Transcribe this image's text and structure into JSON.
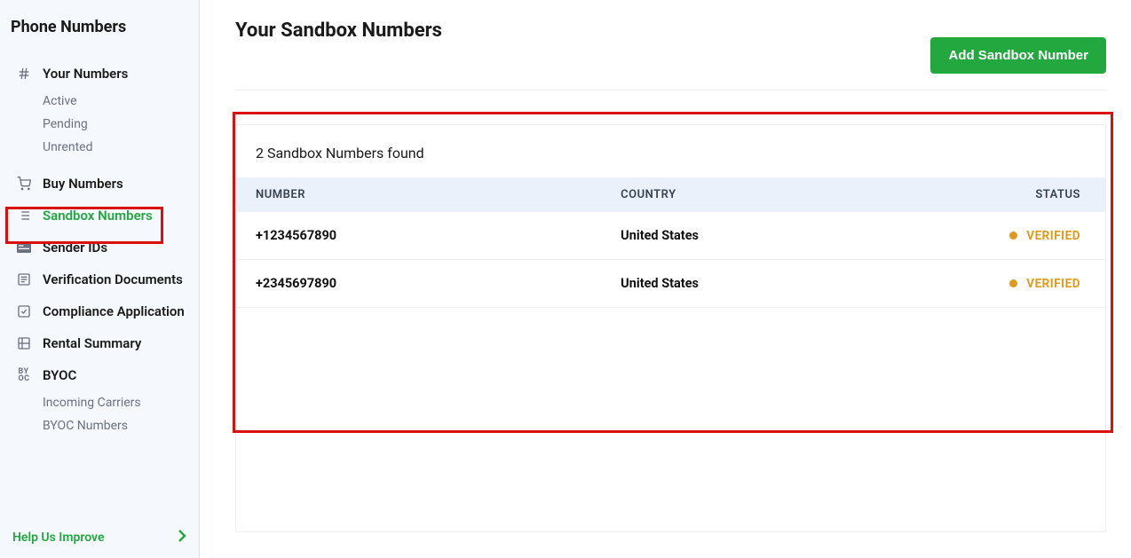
{
  "sidebar": {
    "title": "Phone Numbers",
    "items": [
      {
        "label": "Your Numbers",
        "icon": "#",
        "sub": [
          {
            "label": "Active"
          },
          {
            "label": "Pending"
          },
          {
            "label": "Unrented"
          }
        ]
      },
      {
        "label": "Buy Numbers",
        "icon": "cart"
      },
      {
        "label": "Sandbox Numbers",
        "icon": "list",
        "active": true
      },
      {
        "label": "Sender IDs",
        "icon": "id"
      },
      {
        "label": "Verification Documents",
        "icon": "doc"
      },
      {
        "label": "Compliance Application",
        "icon": "compliance"
      },
      {
        "label": "Rental Summary",
        "icon": "summary"
      },
      {
        "label": "BYOC",
        "icon": "byoc",
        "sub": [
          {
            "label": "Incoming Carriers"
          },
          {
            "label": "BYOC Numbers"
          }
        ]
      }
    ],
    "footer": {
      "label": "Help Us Improve"
    }
  },
  "main": {
    "title": "Your Sandbox Numbers",
    "add_button": "Add Sandbox Number",
    "summary": "2 Sandbox Numbers found",
    "columns": {
      "number": "NUMBER",
      "country": "COUNTRY",
      "status": "STATUS"
    },
    "rows": [
      {
        "number": "+1234567890",
        "country": "United States",
        "status": "VERIFIED"
      },
      {
        "number": "+2345697890",
        "country": "United States",
        "status": "VERIFIED"
      }
    ]
  }
}
